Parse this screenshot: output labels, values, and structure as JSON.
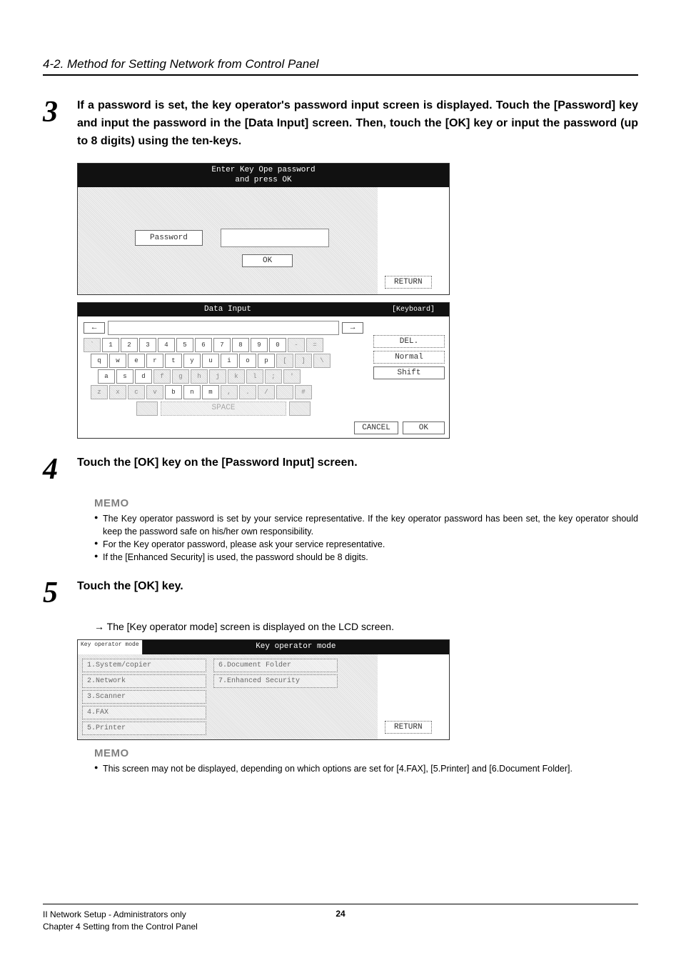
{
  "header": {
    "section_title": "4-2. Method for Setting Network from Control Panel"
  },
  "steps": {
    "s3": {
      "num": "3",
      "text": "If a password is set, the key operator's password input screen is displayed. Touch the [Password] key and input the password in the [Data Input] screen. Then, touch the [OK] key or input the password (up to 8 digits) using the ten-keys."
    },
    "s4": {
      "num": "4",
      "text": "Touch the [OK] key on the [Password Input] screen."
    },
    "s5": {
      "num": "5",
      "text": "Touch the [OK] key."
    }
  },
  "panels": {
    "pwd": {
      "title_l1": "Enter Key Ope password",
      "title_l2": "and press OK",
      "password_btn": "Password",
      "ok_btn": "OK",
      "return_btn": "RETURN"
    },
    "kbd": {
      "title": "Data Input",
      "corner": "[Keyboard]",
      "row1": [
        "`",
        "1",
        "2",
        "3",
        "4",
        "5",
        "6",
        "7",
        "8",
        "9",
        "0",
        "-",
        "="
      ],
      "row2": [
        "q",
        "w",
        "e",
        "r",
        "t",
        "y",
        "u",
        "i",
        "o",
        "p",
        "[",
        "]",
        "\\"
      ],
      "row3": [
        "a",
        "s",
        "d",
        "f",
        "g",
        "h",
        "j",
        "k",
        "l",
        ";",
        "'"
      ],
      "row4": [
        "z",
        "x",
        "c",
        "v",
        "b",
        "n",
        "m",
        ",",
        ".",
        "/",
        "",
        "#"
      ],
      "row2_gray_from": 10,
      "row3_gray_from": 3,
      "row4_gray_from": 0,
      "row4_white": [
        4,
        5,
        6
      ],
      "left_arrow": "←",
      "right_arrow": "→",
      "space": "SPACE",
      "del": "DEL.",
      "normal": "Normal",
      "shift": "Shift",
      "cancel": "CANCEL",
      "ok": "OK"
    },
    "kop": {
      "corner": "Key operator mode",
      "title": "Key operator mode",
      "items_left": [
        "1.System/copier",
        "2.Network",
        "3.Scanner",
        "4.FAX",
        "5.Printer"
      ],
      "items_right": [
        "6.Document Folder",
        "7.Enhanced Security"
      ],
      "return_btn": "RETURN"
    }
  },
  "memos": {
    "label": "MEMO",
    "m4": [
      "The Key operator password is set by your service representative. If the key operator password has been set, the key operator should keep the password safe on his/her own responsibility.",
      "For the Key operator password, please ask your service representative.",
      "If the [Enhanced Security] is used, the password should be 8 digits."
    ],
    "m5": [
      "This screen may not be displayed, depending on which options are set for [4.FAX], [5.Printer] and [6.Document Folder]."
    ]
  },
  "arrow_line": "→  The [Key operator mode] screen is displayed on the LCD screen.",
  "footer": {
    "line1": "II Network Setup - Administrators only",
    "line2": "Chapter 4 Setting from the Control Panel",
    "page": "24"
  }
}
